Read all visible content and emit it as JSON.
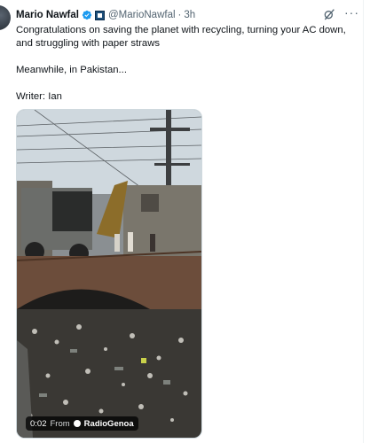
{
  "tweet": {
    "author_name": "Mario Nawfal",
    "handle": "@MarioNawfal",
    "separator": "·",
    "time": "3h",
    "more_label": "···",
    "lines": [
      "Congratulations on saving the planet with recycling, turning your AC down, and struggling with paper straws",
      "Meanwhile, in Pakistan...",
      "Writer: Ian"
    ]
  },
  "video": {
    "duration": "0:02",
    "from_label": "From",
    "source_name": "RadioGenoa"
  },
  "colors": {
    "verified_blue": "#1d9bf0",
    "secondary_text": "#536471"
  },
  "icons": [
    "verified-badge-icon",
    "organization-badge-icon",
    "grok-icon",
    "more-icon"
  ]
}
